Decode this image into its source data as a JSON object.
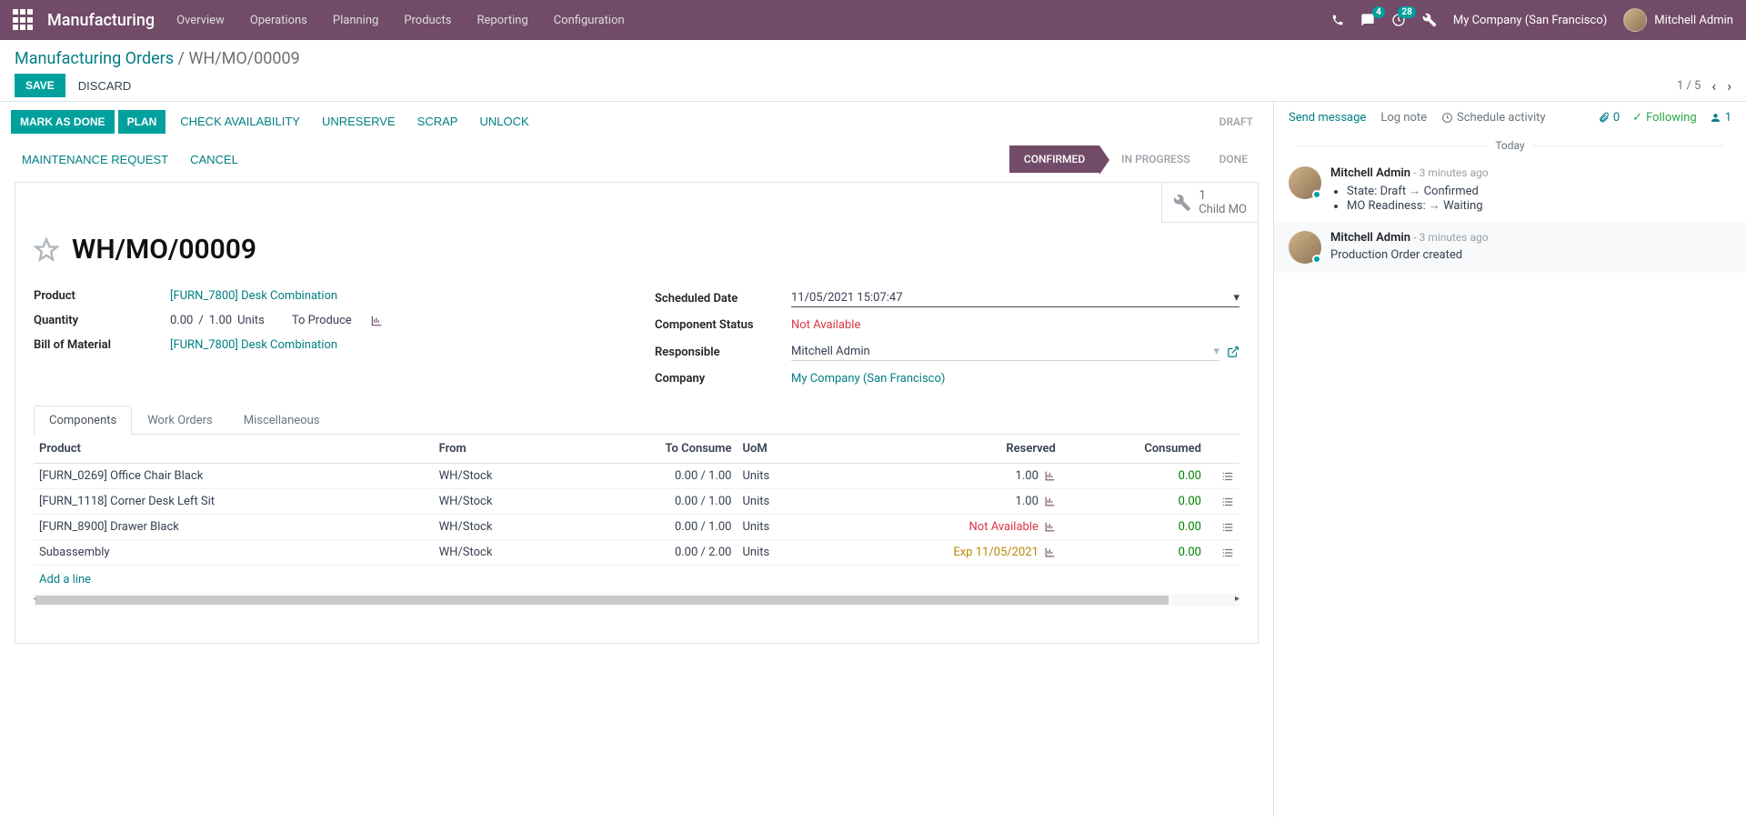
{
  "topnav": {
    "brand": "Manufacturing",
    "menu": [
      "Overview",
      "Operations",
      "Planning",
      "Products",
      "Reporting",
      "Configuration"
    ],
    "msg_badge": "4",
    "clock_badge": "28",
    "company": "My Company (San Francisco)",
    "user": "Mitchell Admin"
  },
  "breadcrumb": {
    "root": "Manufacturing Orders",
    "current": "WH/MO/00009"
  },
  "buttons": {
    "save": "SAVE",
    "discard": "DISCARD"
  },
  "pager": {
    "text": "1 / 5"
  },
  "actions": {
    "mark_done": "MARK AS DONE",
    "plan": "PLAN",
    "check": "CHECK AVAILABILITY",
    "unreserve": "UNRESERVE",
    "scrap": "SCRAP",
    "unlock": "UNLOCK",
    "draft": "DRAFT",
    "maintenance": "MAINTENANCE REQUEST",
    "cancel": "CANCEL"
  },
  "status": {
    "confirmed": "CONFIRMED",
    "in_progress": "IN PROGRESS",
    "done": "DONE"
  },
  "stat": {
    "count": "1",
    "label": "Child MO"
  },
  "title": "WH/MO/00009",
  "form": {
    "product_label": "Product",
    "product": "[FURN_7800] Desk Combination",
    "quantity_label": "Quantity",
    "qty": "0.00",
    "qty_sep": "/",
    "qty_target": "1.00",
    "uom": "Units",
    "to_produce": "To Produce",
    "bom_label": "Bill of Material",
    "bom": "[FURN_7800] Desk Combination",
    "sched_label": "Scheduled Date",
    "sched": "11/05/2021 15:07:47",
    "comp_status_label": "Component Status",
    "comp_status": "Not Available",
    "resp_label": "Responsible",
    "resp": "Mitchell Admin",
    "company_label": "Company",
    "company": "My Company (San Francisco)"
  },
  "tabs": [
    "Components",
    "Work Orders",
    "Miscellaneous"
  ],
  "table": {
    "headers": {
      "product": "Product",
      "from": "From",
      "to_consume": "To Consume",
      "uom": "UoM",
      "reserved": "Reserved",
      "consumed": "Consumed"
    },
    "rows": [
      {
        "product": "[FURN_0269] Office Chair Black",
        "from": "WH/Stock",
        "tc": "0.00 / 1.00",
        "uom": "Units",
        "reserved": "1.00",
        "reserved_class": "",
        "consumed": "0.00"
      },
      {
        "product": "[FURN_1118] Corner Desk Left Sit",
        "from": "WH/Stock",
        "tc": "0.00 / 1.00",
        "uom": "Units",
        "reserved": "1.00",
        "reserved_class": "",
        "consumed": "0.00"
      },
      {
        "product": "[FURN_8900] Drawer Black",
        "from": "WH/Stock",
        "tc": "0.00 / 1.00",
        "uom": "Units",
        "reserved": "Not Available",
        "reserved_class": "red",
        "consumed": "0.00"
      },
      {
        "product": "Subassembly",
        "from": "WH/Stock",
        "tc": "0.00 / 2.00",
        "uom": "Units",
        "reserved": "Exp 11/05/2021",
        "reserved_class": "amber",
        "consumed": "0.00"
      }
    ],
    "add_line": "Add a line"
  },
  "chatter": {
    "send": "Send message",
    "log": "Log note",
    "schedule": "Schedule activity",
    "attach_count": "0",
    "following": "Following",
    "followers": "1",
    "sep": "Today",
    "msgs": [
      {
        "author": "Mitchell Admin",
        "time": "- 3 minutes ago",
        "changes": [
          {
            "field": "State:",
            "from": "Draft",
            "to": "Confirmed"
          },
          {
            "field": "MO Readiness:",
            "from": "",
            "to": "Waiting"
          }
        ]
      },
      {
        "author": "Mitchell Admin",
        "time": "- 3 minutes ago",
        "body": "Production Order created"
      }
    ]
  }
}
